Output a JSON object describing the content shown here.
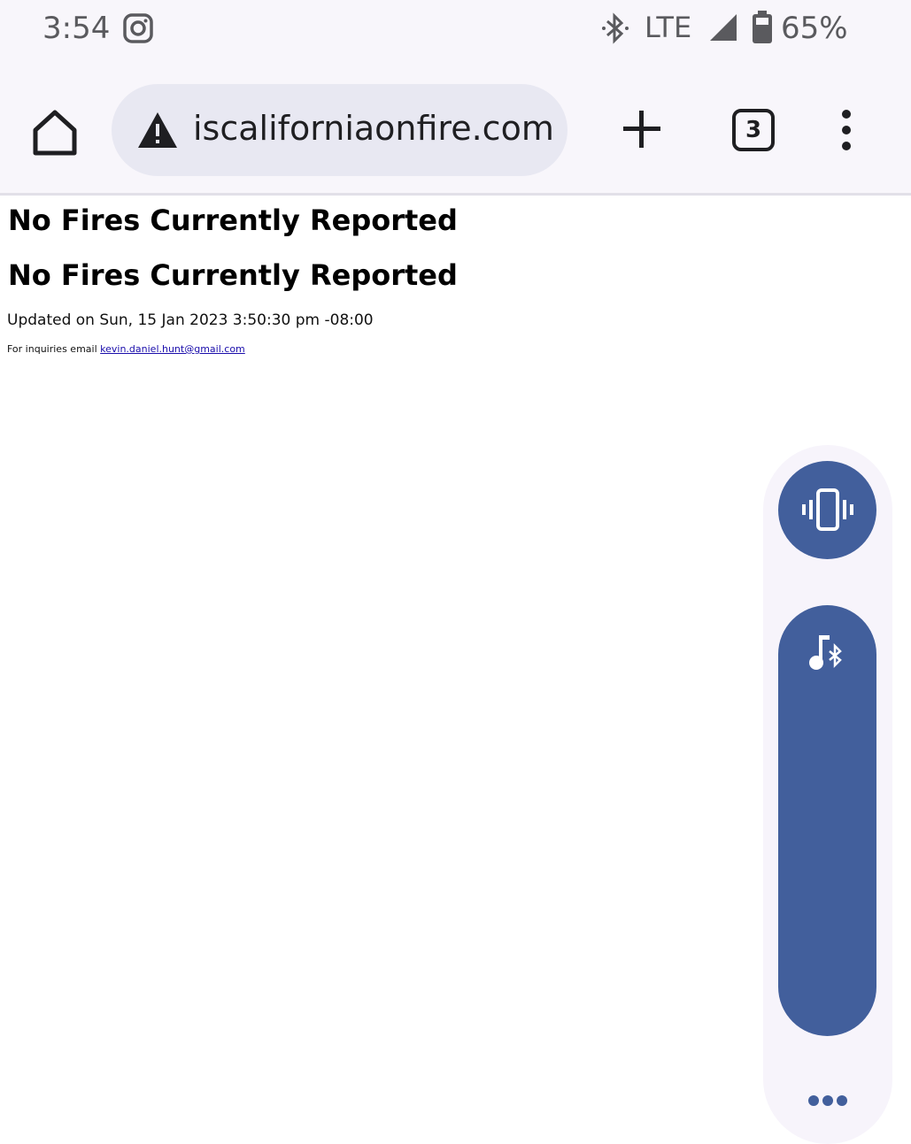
{
  "status_bar": {
    "time": "3:54",
    "network": "LTE",
    "battery": "65%",
    "icons": [
      "instagram-icon",
      "bluetooth-icon",
      "signal-icon",
      "battery-icon"
    ]
  },
  "toolbar": {
    "url": "iscaliforniaonfire.com",
    "tab_count": "3",
    "icons": [
      "home-icon",
      "warning-icon",
      "plus-icon",
      "tabs-icon",
      "more-vert-icon"
    ]
  },
  "page": {
    "heading_1": "No Fires Currently Reported",
    "heading_2": "No Fires Currently Reported",
    "updated": "Updated on Sun, 15 Jan 2023 3:50:30 pm -08:00",
    "inquiries_prefix": "For inquiries email ",
    "email": "kevin.daniel.hunt@gmail.com"
  },
  "volume_panel": {
    "accent_color": "#425f9c",
    "volume_level_fraction": 1.0,
    "icons": [
      "vibrate-icon",
      "music-bluetooth-icon",
      "more-horiz-icon"
    ]
  }
}
